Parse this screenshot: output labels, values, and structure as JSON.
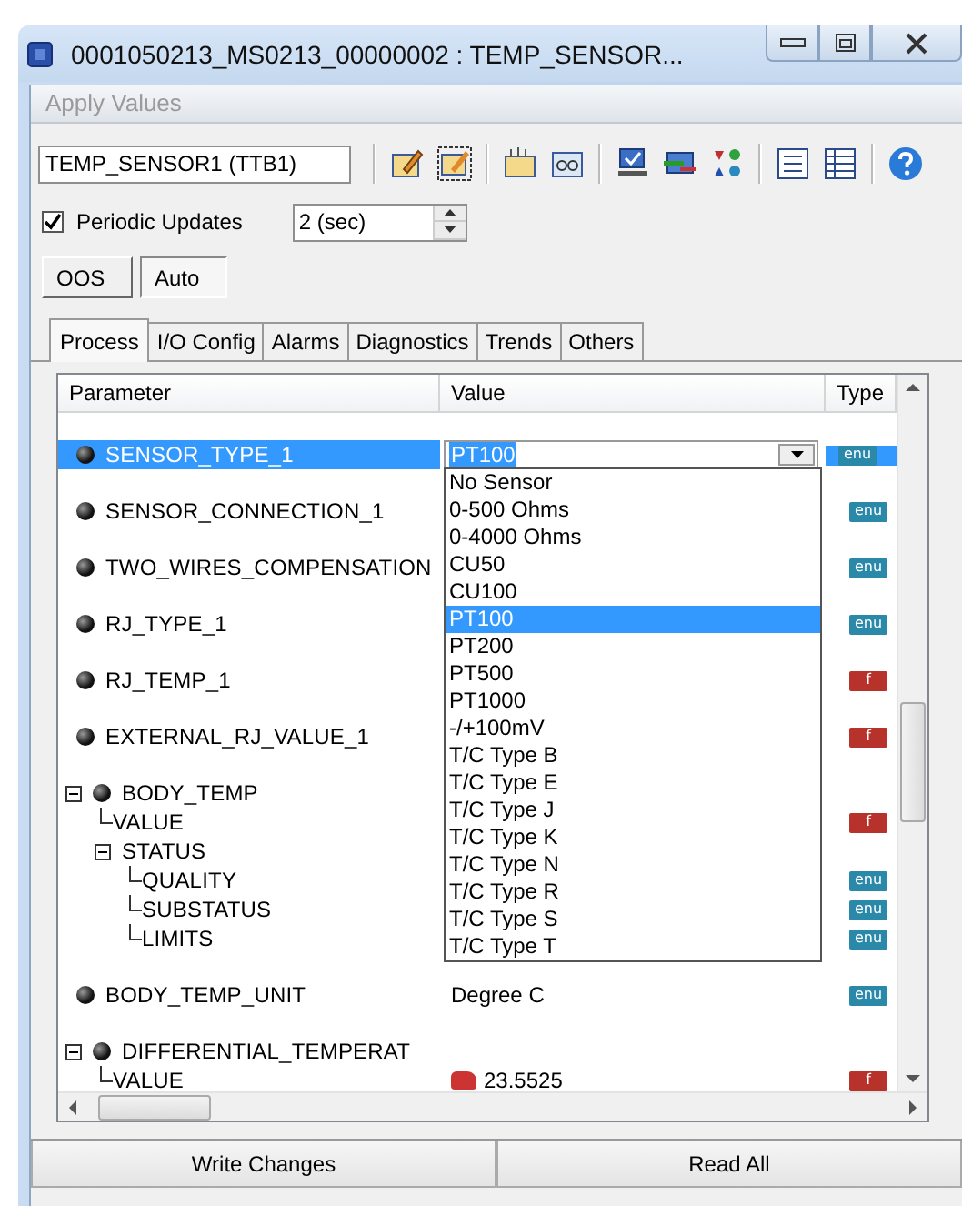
{
  "window": {
    "title": "0001050213_MS0213_00000002 : TEMP_SENSOR..."
  },
  "menu": {
    "label": "Apply Values",
    "disabled": true
  },
  "toolbar": {
    "block": "TEMP_SENSOR1 (TTB1)"
  },
  "periodic_updates": {
    "label": "Periodic Updates",
    "checked": true,
    "interval": "2 (sec)"
  },
  "modes": [
    {
      "label": "OOS",
      "selected": false
    },
    {
      "label": "Auto",
      "selected": true
    }
  ],
  "tabs": [
    {
      "label": "Process",
      "selected": true
    },
    {
      "label": "I/O Config",
      "selected": false
    },
    {
      "label": "Alarms",
      "selected": false
    },
    {
      "label": "Diagnostics",
      "selected": false
    },
    {
      "label": "Trends",
      "selected": false
    },
    {
      "label": "Others",
      "selected": false
    }
  ],
  "table": {
    "columns": [
      "Parameter",
      "Value",
      "Type"
    ],
    "rows": [
      {
        "name": "SENSOR_TYPE_1",
        "selected": true,
        "type": {
          "kind": "enum",
          "label": "enu"
        }
      },
      {
        "name": "SENSOR_CONNECTION_1",
        "selected": false,
        "type": {
          "kind": "enum",
          "label": "enu"
        }
      },
      {
        "name": "TWO_WIRES_COMPENSATION",
        "selected": false,
        "type": {
          "kind": "enum",
          "label": "enu"
        }
      },
      {
        "name": "RJ_TYPE_1",
        "selected": false,
        "type": {
          "kind": "enum",
          "label": "enu"
        }
      },
      {
        "name": "RJ_TEMP_1",
        "selected": false,
        "type": {
          "kind": "float",
          "label": "f"
        }
      },
      {
        "name": "EXTERNAL_RJ_VALUE_1",
        "selected": false,
        "type": {
          "kind": "float",
          "label": "f"
        }
      },
      {
        "name": "BODY_TEMP",
        "selected": false,
        "expanded": true,
        "children": [
          {
            "name": "VALUE",
            "selected": false,
            "type": {
              "kind": "float",
              "label": "f"
            }
          },
          {
            "name": "STATUS",
            "selected": false,
            "expanded": true,
            "children": [
              {
                "name": "QUALITY",
                "selected": false,
                "type": {
                  "kind": "enum",
                  "label": "enu"
                }
              },
              {
                "name": "SUBSTATUS",
                "selected": false,
                "type": {
                  "kind": "enum",
                  "label": "enu"
                }
              },
              {
                "name": "LIMITS",
                "selected": false,
                "type": {
                  "kind": "enum",
                  "label": "enu"
                }
              }
            ]
          }
        ]
      },
      {
        "name": "BODY_TEMP_UNIT",
        "selected": false,
        "value": "Degree C",
        "type": {
          "kind": "enum",
          "label": "enu"
        }
      },
      {
        "name": "DIFFERENTIAL_TEMPERAT",
        "selected": false,
        "expanded": true,
        "children": [
          {
            "name": "VALUE",
            "selected": false,
            "value": "23.5525",
            "value_icon": true,
            "type": {
              "kind": "float",
              "label": "f"
            }
          }
        ]
      }
    ]
  },
  "dropdown": {
    "value": "PT100",
    "options": [
      {
        "label": "No Sensor",
        "selected": false
      },
      {
        "label": "0-500 Ohms",
        "selected": false
      },
      {
        "label": "0-4000 Ohms",
        "selected": false
      },
      {
        "label": "CU50",
        "selected": false
      },
      {
        "label": "CU100",
        "selected": false
      },
      {
        "label": "PT100",
        "selected": true
      },
      {
        "label": "PT200",
        "selected": false
      },
      {
        "label": "PT500",
        "selected": false
      },
      {
        "label": "PT1000",
        "selected": false
      },
      {
        "label": "-/+100mV",
        "selected": false
      },
      {
        "label": "T/C Type B",
        "selected": false
      },
      {
        "label": "T/C Type E",
        "selected": false
      },
      {
        "label": "T/C Type J",
        "selected": false
      },
      {
        "label": "T/C Type K",
        "selected": false
      },
      {
        "label": "T/C Type N",
        "selected": false
      },
      {
        "label": "T/C Type R",
        "selected": false
      },
      {
        "label": "T/C Type S",
        "selected": false
      },
      {
        "label": "T/C Type T",
        "selected": false
      }
    ]
  },
  "buttons": [
    "Write Changes",
    "Read All"
  ]
}
